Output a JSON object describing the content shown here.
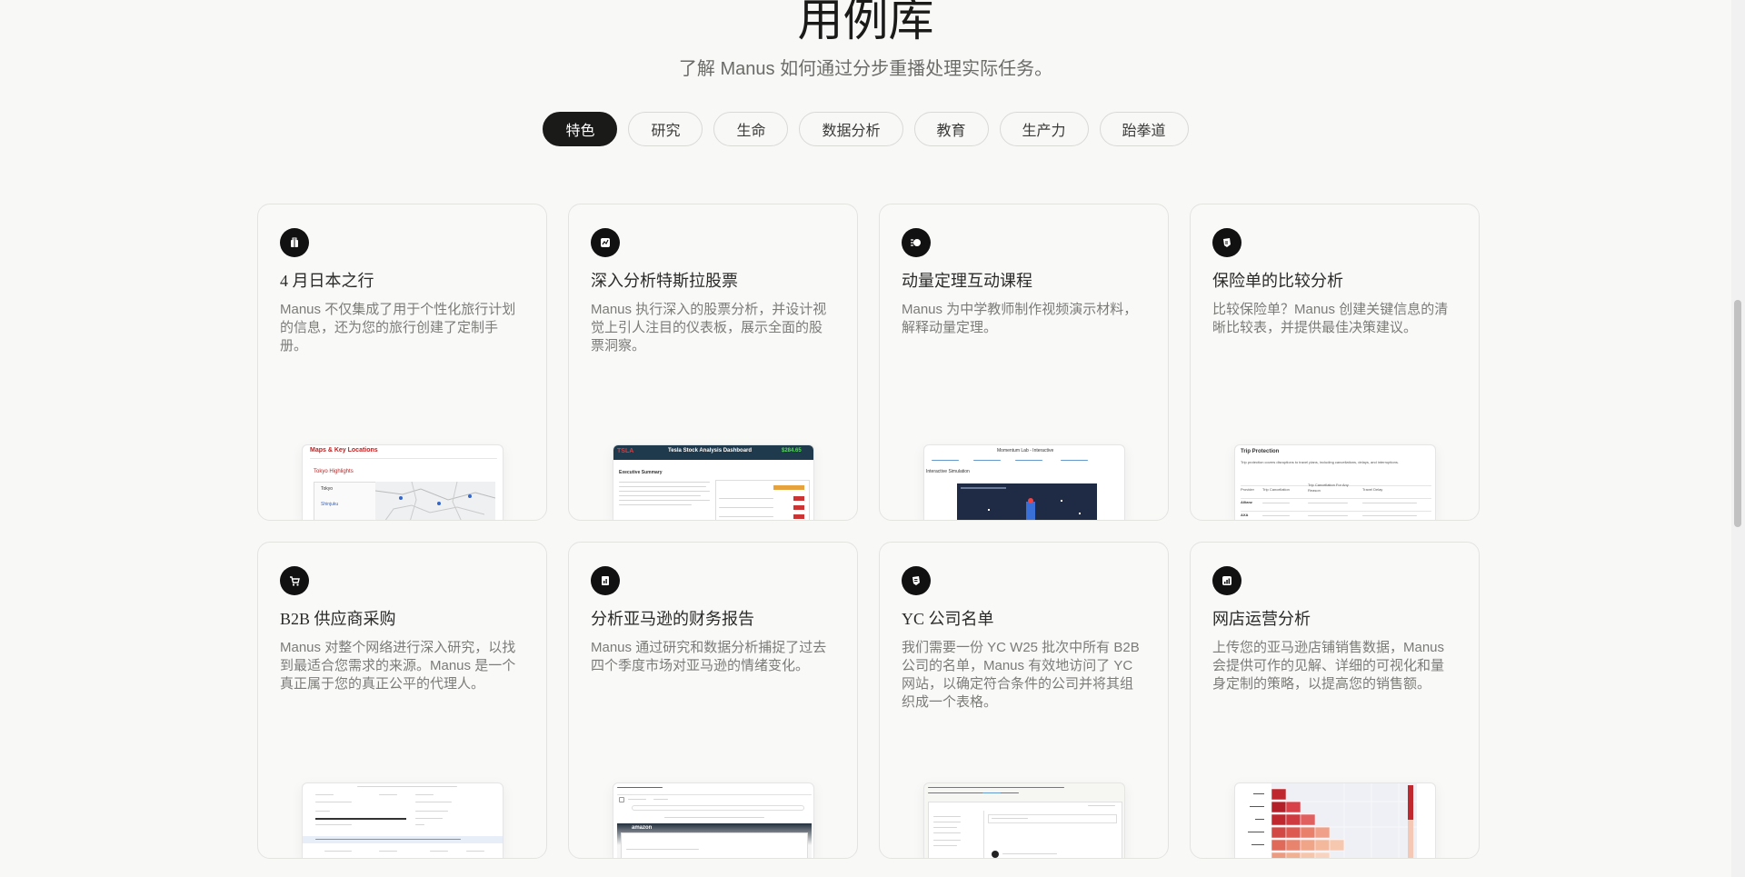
{
  "header": {
    "title": "用例库",
    "subtitle": "了解 Manus 如何通过分步重播处理实际任务。"
  },
  "tabs": [
    {
      "label": "特色",
      "active": true
    },
    {
      "label": "研究",
      "active": false
    },
    {
      "label": "生命",
      "active": false
    },
    {
      "label": "数据分析",
      "active": false
    },
    {
      "label": "教育",
      "active": false
    },
    {
      "label": "生产力",
      "active": false
    },
    {
      "label": "跆拳道",
      "active": false
    }
  ],
  "cards": [
    {
      "icon": "travel-icon",
      "title": "4 月日本之行",
      "desc": "Manus 不仅集成了用于个性化旅行计划的信息，还为您的旅行创建了定制手册。",
      "preview": {
        "heading": "Maps & Key Locations",
        "sub": "Tokyo Highlights",
        "label1": "Tokyo",
        "label2": "Shinjuku"
      }
    },
    {
      "icon": "stock-icon",
      "title": "深入分析特斯拉股票",
      "desc": "Manus 执行深入的股票分析，并设计视觉上引人注目的仪表板，展示全面的股票洞察。",
      "preview": {
        "ticker": "TSLA",
        "heading": "Tesla Stock Analysis Dashboard",
        "price": "$284.65",
        "section": "Executive Summary"
      }
    },
    {
      "icon": "physics-icon",
      "title": "动量定理互动课程",
      "desc": "Manus 为中学教师制作视频演示材料，解释动量定理。",
      "preview": {
        "heading": "Momentum Lab - Interactive",
        "sub": "Interactive Simulation"
      }
    },
    {
      "icon": "insurance-icon",
      "title": "保险单的比较分析",
      "desc": "比较保险单？Manus 创建关键信息的清晰比较表，并提供最佳决策建议。",
      "preview": {
        "heading": "Trip Protection",
        "sub": "Trip protection covers disruptions to travel plans, including cancellations, delays, and interruptions.",
        "col1": "Provider",
        "col2": "Trip Cancellation",
        "col3": "Trip Cancellation For Any Reason",
        "col4": "Travel Delay",
        "row1": "Allianz",
        "row2": "AXA"
      }
    },
    {
      "icon": "cart-icon",
      "title": "B2B 供应商采购",
      "desc": "Manus 对整个网络进行深入研究，以找到最适合您需求的来源。Manus 是一个真正属于您的真正公平的代理人。",
      "preview": {
        "heading": "Supplier Sourcing Results"
      }
    },
    {
      "icon": "report-icon",
      "title": "分析亚马逊的财务报告",
      "desc": "Manus 通过研究和数据分析捕捉了过去四个季度市场对亚马逊的情绪变化。",
      "preview": {
        "heading": "Amazon Sentiment",
        "brand": "amazon"
      }
    },
    {
      "icon": "list-icon",
      "title": "YC 公司名单",
      "desc": "我们需要一份 YC W25 批次中所有 B2B 公司的名单，Manus 有效地访问了 YC 网站，以确定符合条件的公司并将其组织成一个表格。",
      "preview": {
        "heading": "YC W25 B2B Companies"
      }
    },
    {
      "icon": "chart-icon",
      "title": "网店运营分析",
      "desc": "上传您的亚马逊店铺销售数据，Manus 会提供可作的见解、详细的可视化和量身定制的策略，以提高您的销售额。",
      "preview": {
        "heading": "Sales Heatmap"
      }
    }
  ]
}
